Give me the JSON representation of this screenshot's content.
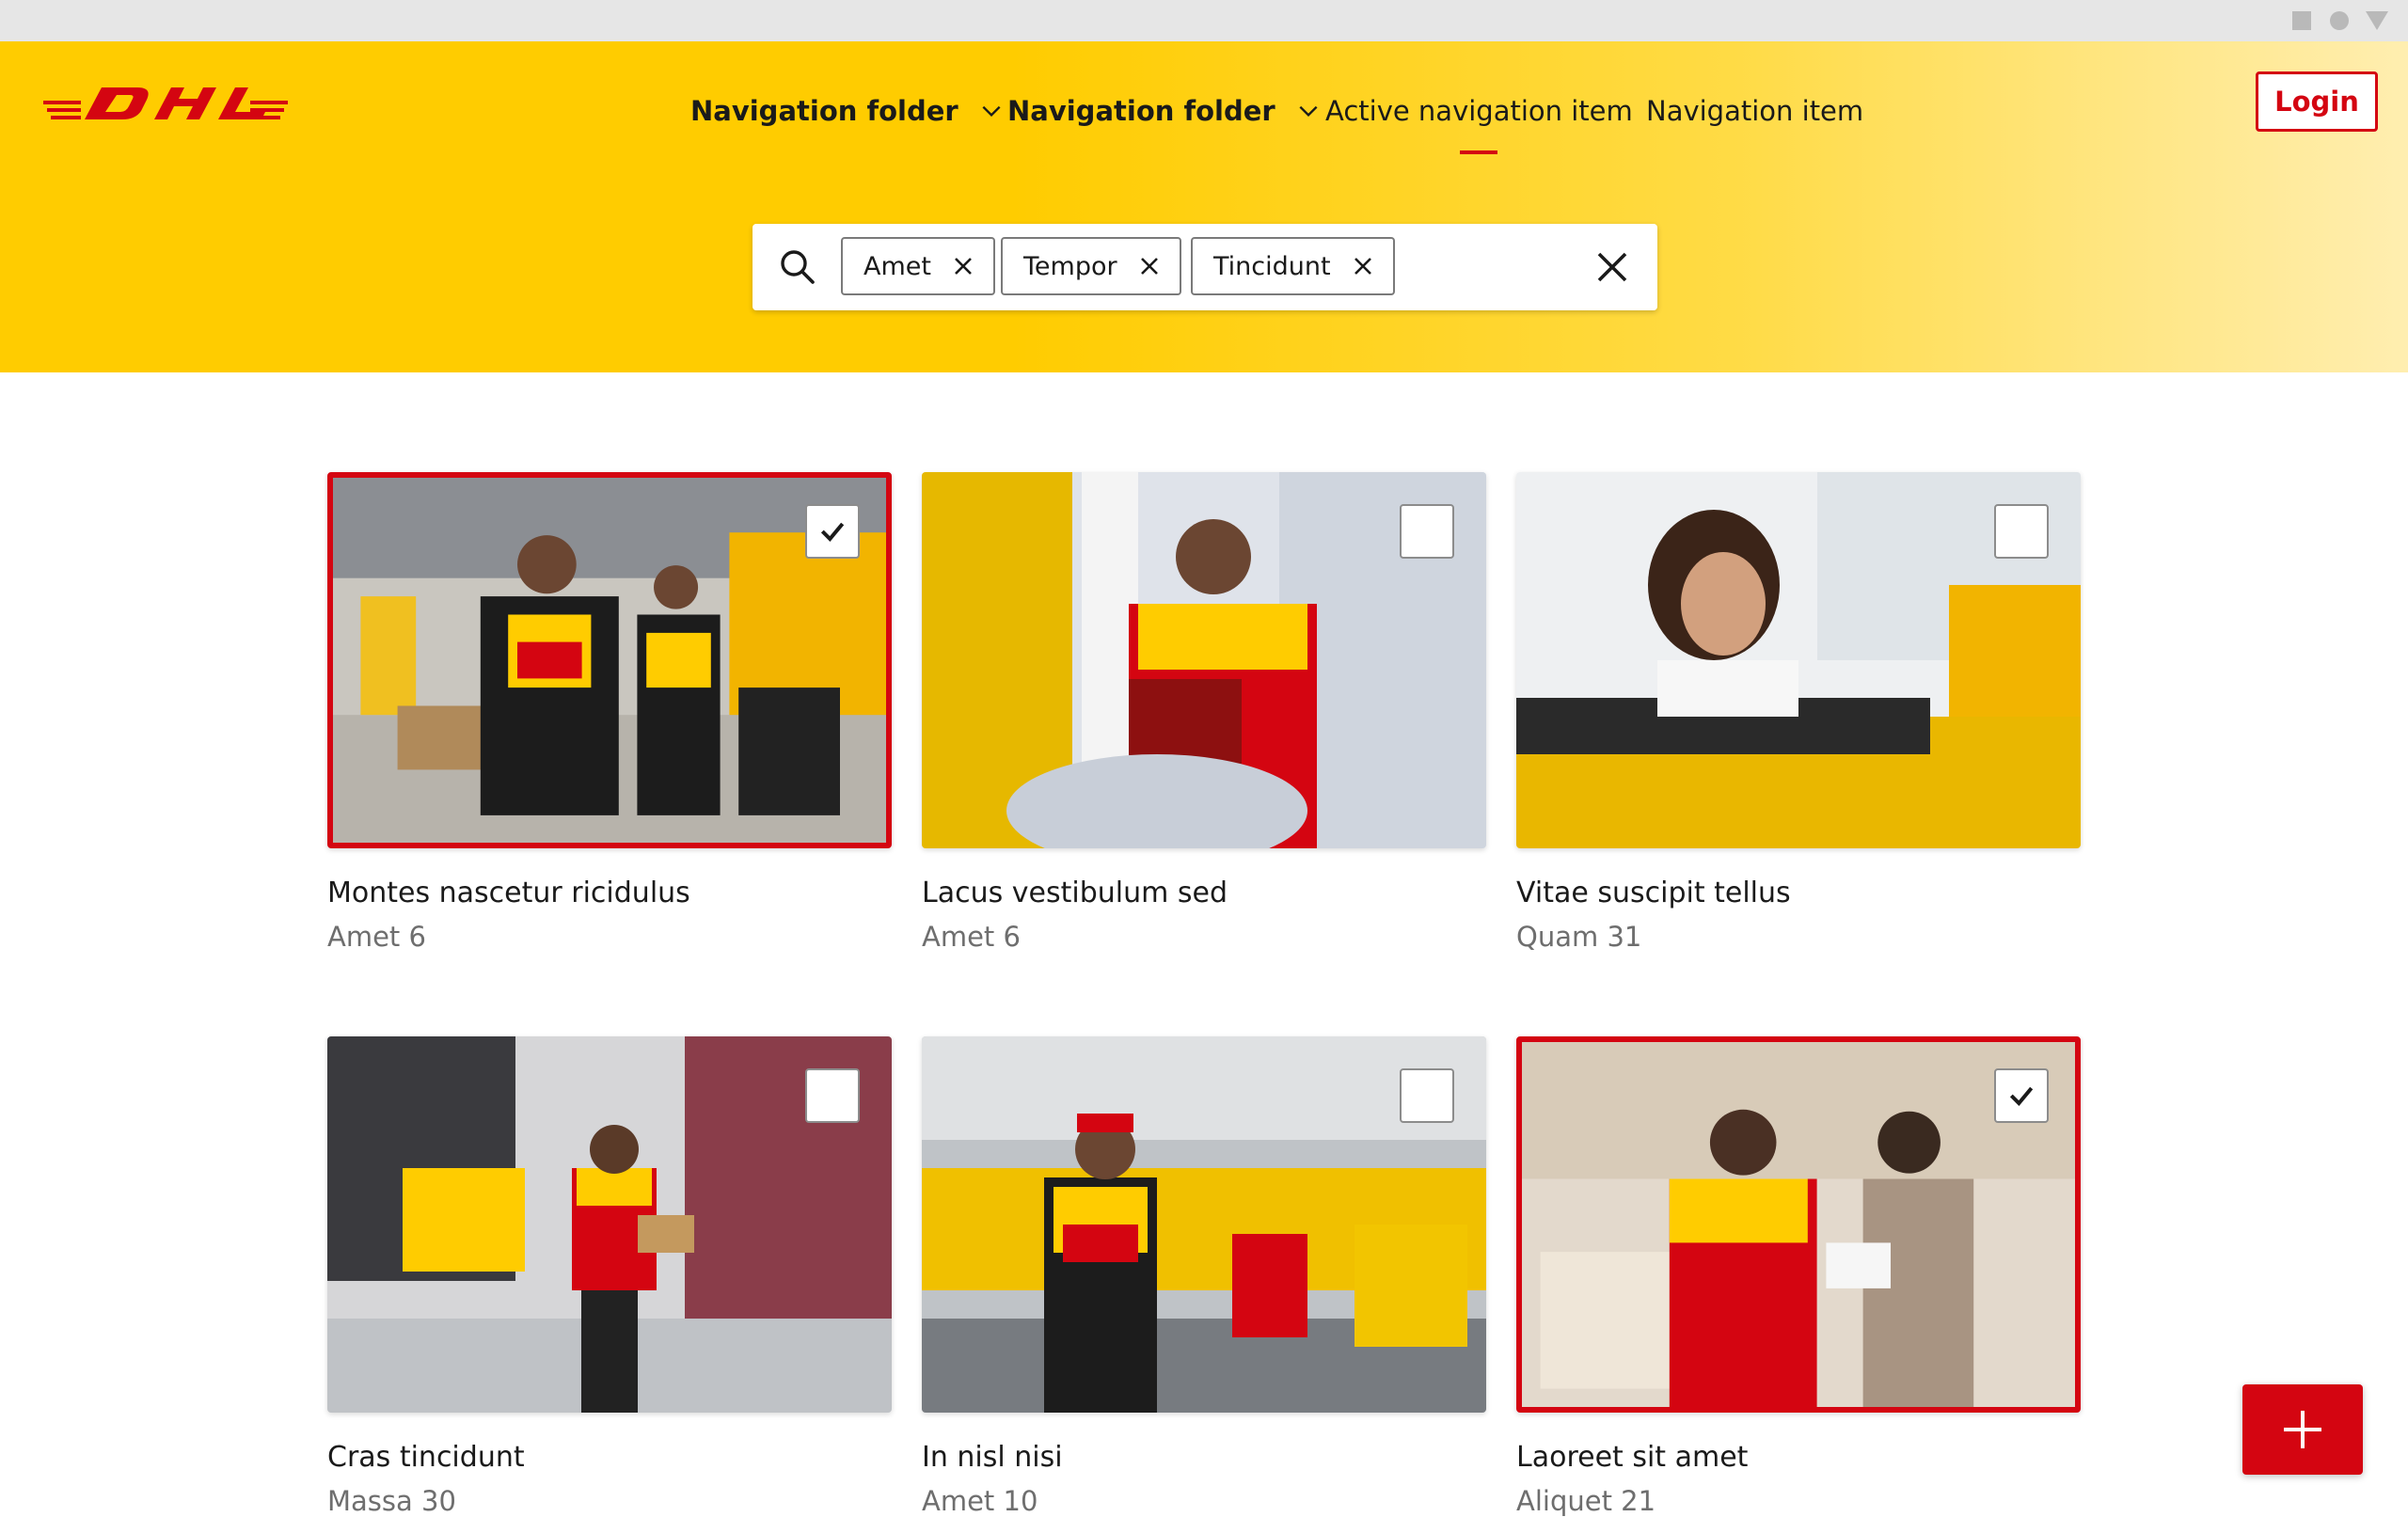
{
  "brand": {
    "logo_text": "DHL",
    "primary": "#ffcc00",
    "accent": "#d40511"
  },
  "nav": {
    "items": [
      {
        "label": "Navigation folder",
        "type": "folder"
      },
      {
        "label": "Navigation folder",
        "type": "folder"
      },
      {
        "label": "Active navigation item",
        "type": "active"
      },
      {
        "label": "Navigation item",
        "type": "item"
      }
    ],
    "login_label": "Login"
  },
  "search": {
    "chips": [
      "Amet",
      "Tempor",
      "Tincidunt"
    ],
    "icon": "search-icon",
    "clear_icon": "close-icon"
  },
  "cards": [
    {
      "title": "Montes nascetur ricidulus",
      "subtitle": "Amet 6",
      "selected": true
    },
    {
      "title": "Lacus vestibulum sed",
      "subtitle": "Amet 6",
      "selected": false
    },
    {
      "title": "Vitae suscipit tellus",
      "subtitle": "Quam 31",
      "selected": false
    },
    {
      "title": "Cras tincidunt",
      "subtitle": "Massa 30",
      "selected": false
    },
    {
      "title": "In nisl nisi",
      "subtitle": "Amet 10",
      "selected": false
    },
    {
      "title": "Laoreet sit amet",
      "subtitle": "Aliquet 21",
      "selected": true
    }
  ],
  "fab": {
    "icon": "plus-icon"
  }
}
